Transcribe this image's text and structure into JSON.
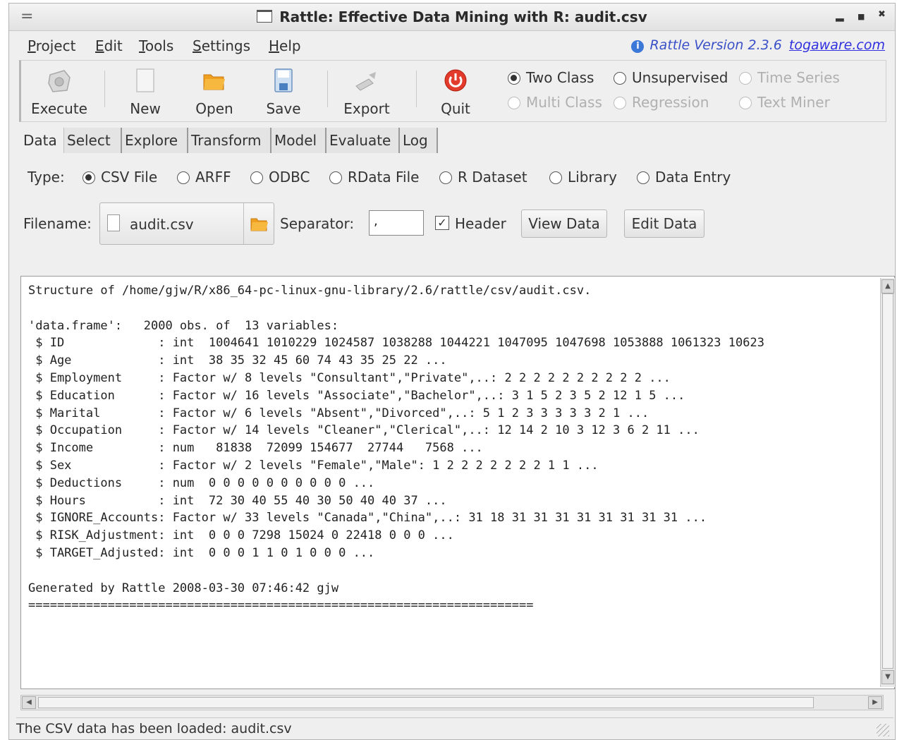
{
  "window": {
    "title": "Rattle: Effective Data Mining with R: audit.csv",
    "menu_glyph": "=",
    "minimize": "▂",
    "maximize": "■",
    "close": "✖"
  },
  "menubar": {
    "items": [
      "Project",
      "Edit",
      "Tools",
      "Settings",
      "Help"
    ],
    "version_label": "Rattle Version 2.3.6",
    "version_link": "togaware.com"
  },
  "toolbar": {
    "execute": "Execute",
    "new": "New",
    "open": "Open",
    "save": "Save",
    "export": "Export",
    "quit": "Quit"
  },
  "modes": {
    "two_class": "Two Class",
    "unsupervised": "Unsupervised",
    "time_series": "Time Series",
    "multi_class": "Multi Class",
    "regression": "Regression",
    "text_miner": "Text Miner",
    "selected": "Two Class"
  },
  "tabs": [
    "Data",
    "Select",
    "Explore",
    "Transform",
    "Model",
    "Evaluate",
    "Log"
  ],
  "active_tab": "Data",
  "data_tab": {
    "type_label": "Type:",
    "types": [
      "CSV File",
      "ARFF",
      "ODBC",
      "RData File",
      "R Dataset",
      "Library",
      "Data Entry"
    ],
    "selected_type": "CSV File",
    "filename_label": "Filename:",
    "filename": "audit.csv",
    "separator_label": "Separator:",
    "separator_value": ",",
    "header_label": "Header",
    "header_checked": true,
    "view_data": "View Data",
    "edit_data": "Edit Data"
  },
  "output": {
    "lines": [
      "Structure of /home/gjw/R/x86_64-pc-linux-gnu-library/2.6/rattle/csv/audit.csv.",
      "",
      "'data.frame':   2000 obs. of  13 variables:",
      " $ ID             : int  1004641 1010229 1024587 1038288 1044221 1047095 1047698 1053888 1061323 10623",
      " $ Age            : int  38 35 32 45 60 74 43 35 25 22 ...",
      " $ Employment     : Factor w/ 8 levels \"Consultant\",\"Private\",..: 2 2 2 2 2 2 2 2 2 2 ...",
      " $ Education      : Factor w/ 16 levels \"Associate\",\"Bachelor\",..: 3 1 5 2 3 5 2 12 1 5 ...",
      " $ Marital        : Factor w/ 6 levels \"Absent\",\"Divorced\",..: 5 1 2 3 3 3 3 3 2 1 ...",
      " $ Occupation     : Factor w/ 14 levels \"Cleaner\",\"Clerical\",..: 12 14 2 10 3 12 3 6 2 11 ...",
      " $ Income         : num   81838  72099 154677  27744   7568 ...",
      " $ Sex            : Factor w/ 2 levels \"Female\",\"Male\": 1 2 2 2 2 2 2 2 1 1 ...",
      " $ Deductions     : num  0 0 0 0 0 0 0 0 0 0 ...",
      " $ Hours          : int  72 30 40 55 40 30 50 40 40 37 ...",
      " $ IGNORE_Accounts: Factor w/ 33 levels \"Canada\",\"China\",..: 31 18 31 31 31 31 31 31 31 31 ...",
      " $ RISK_Adjustment: int  0 0 0 7298 15024 0 22418 0 0 0 ...",
      " $ TARGET_Adjusted: int  0 0 0 1 1 0 1 0 0 0 ...",
      "",
      "Generated by Rattle 2008-03-30 07:46:42 gjw",
      "======================================================================"
    ]
  },
  "status": "The CSV data has been loaded: audit.csv"
}
